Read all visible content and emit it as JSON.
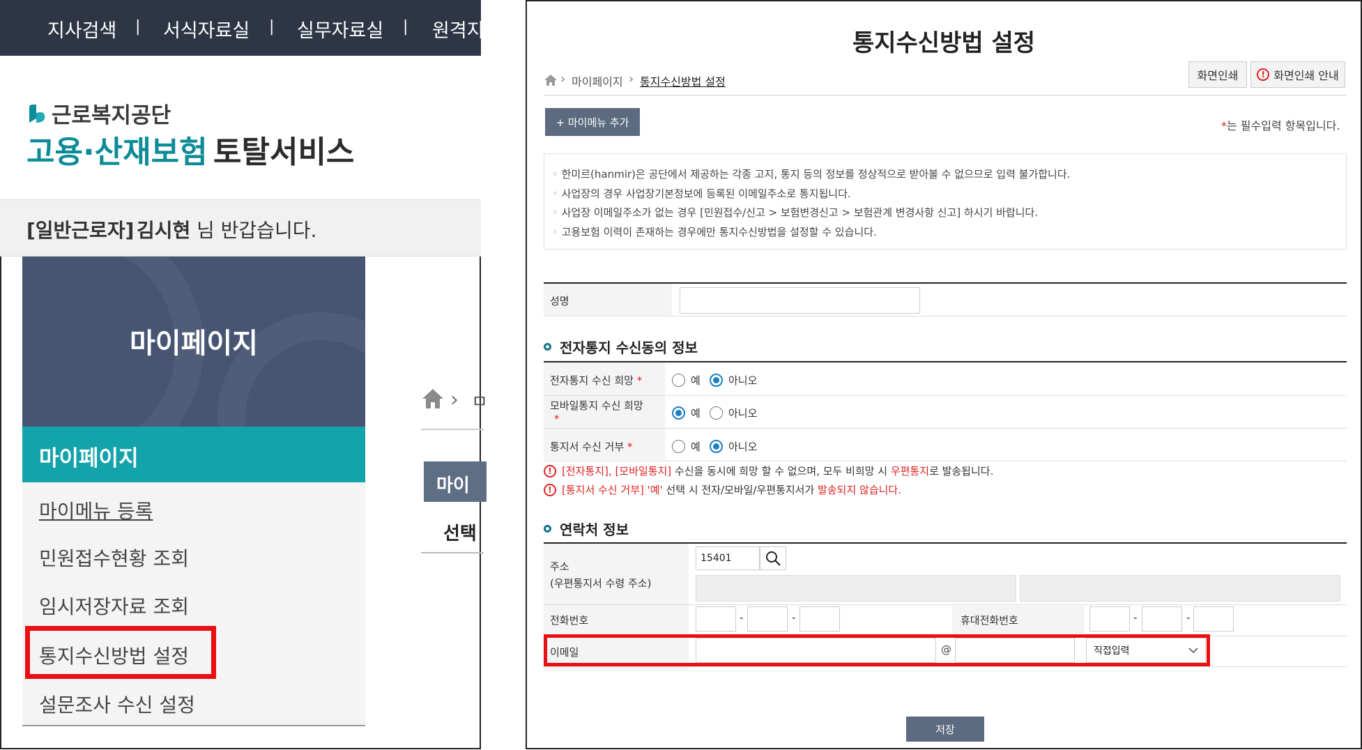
{
  "left_panel": {
    "topnav": [
      "지사검색",
      "서식자료실",
      "실무자료실",
      "원격지"
    ],
    "org_name": "근로복지공단",
    "service_name_colored": "고용·산재보험",
    "service_name_dark": "토탈서비스",
    "greeting": {
      "role": "[일반근로자]",
      "name": "김시현",
      "suffix": "님 반갑습니다."
    },
    "sidebar": {
      "hero_title": "마이페이지",
      "active_section": "마이페이지",
      "items": [
        "마이메뉴 등록",
        "민원접수현황 조회",
        "임시저장자료 조회",
        "통지수신방법 설정",
        "설문조사 수신 설정"
      ]
    },
    "fragments": {
      "breadcrumb_char": "ㅁ",
      "tab_label": "마이",
      "select_label": "선택"
    }
  },
  "right_panel": {
    "title": "통지수신방법 설정",
    "breadcrumb": [
      "마이페이지",
      "통지수신방법 설정"
    ],
    "print_button": "화면인쇄",
    "print_guide_button": "화면인쇄 안내",
    "mymenu_button": "+ 마이메뉴 추가",
    "required_note": "는 필수입력 항목입니다.",
    "required_marker": "*",
    "notices": [
      "한미르(hanmir)은 공단에서 제공하는 각종 고지, 통지 등의 정보를 정상적으로 받아볼 수 없으므로 입력 불가합니다.",
      "사업장의 경우 사업장기본정보에 등록된 이메일주소로 통지됩니다.",
      "사업장 이메일주소가 없는 경우 [민원접수/신고 > 보험변경신고 > 보험관계 변경사항 신고] 하시기 바랍니다.",
      "고용보험 이력이 존재하는 경우에만 통지수신방법을 설정할 수 있습니다."
    ],
    "name_label": "성명",
    "name_value": "",
    "section_electronic": "전자통지 수신동의 정보",
    "electronic_rows": [
      {
        "label": "전자통지 수신 희망",
        "selected": "아니오"
      },
      {
        "label": "모바일통지 수신 희망",
        "selected": "예"
      },
      {
        "label": "통지서 수신 거부",
        "selected": "아니오"
      }
    ],
    "radio_yes": "예",
    "radio_no": "아니오",
    "warning1": {
      "part1": "[전자통지], [모바일통지]",
      "part2": " 수신을 동시에 희망 할 수 없으며, 모두 비희망 시 ",
      "part3": "우편통지",
      "part4": "로 발송됩니다."
    },
    "warning2": {
      "part1": "[통지서 수신 거부] '예'",
      "part2": " 선택 시 전자/모바일/우편통지서가 ",
      "part3": "발송되지 않습니다."
    },
    "section_contact": "연락처 정보",
    "address_label": "주소",
    "address_sublabel": "(우편통지서 수령 주소)",
    "postal_code": "15401",
    "phone_label": "전화번호",
    "mobile_label": "휴대전화번호",
    "email_label": "이메일",
    "email_at": "@",
    "email_domain_select": "직접입력",
    "save_button": "저장"
  },
  "colors": {
    "teal": "#13a3aa",
    "navy": "#2e3545",
    "sidebar_hero": "#475573",
    "highlight_red": "#e90f12",
    "button_gray": "#5c6b80"
  }
}
